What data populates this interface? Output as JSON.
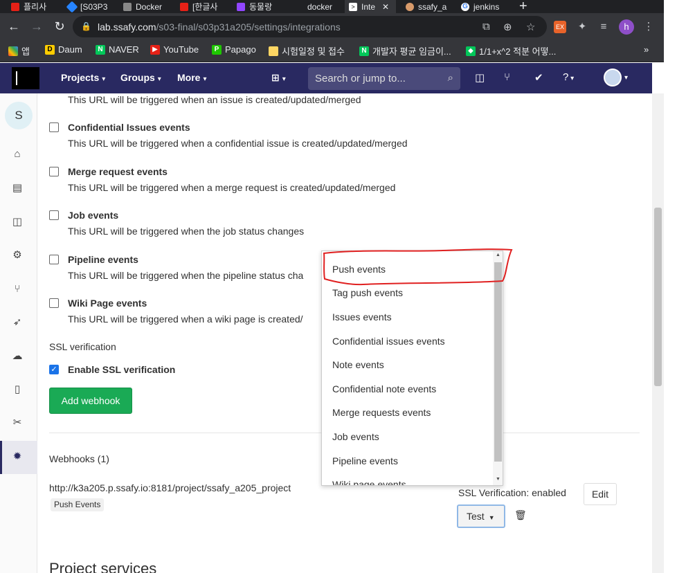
{
  "browser": {
    "tabs": [
      {
        "label": "플리사"
      },
      {
        "label": "[S03P3"
      },
      {
        "label": "Docker"
      },
      {
        "label": "[한글사"
      },
      {
        "label": "동물랑"
      },
      {
        "label": "docker"
      },
      {
        "label": "Inte"
      },
      {
        "label": "ssafy_a"
      },
      {
        "label": "jenkins"
      }
    ],
    "url_host": "lab.ssafy.com",
    "url_path": "/s03-final/s03p31a205/settings/integrations",
    "profile_initial": "h",
    "bookmarks": [
      {
        "label": "앱"
      },
      {
        "label": "Daum"
      },
      {
        "label": "NAVER"
      },
      {
        "label": "YouTube"
      },
      {
        "label": "Papago"
      },
      {
        "label": "시험일정 및 접수"
      },
      {
        "label": "개발자 평균 임금이..."
      },
      {
        "label": "1/1+x^2 적분 어떻..."
      }
    ],
    "more_bookmarks": "»"
  },
  "gitlab_nav": {
    "projects": "Projects",
    "groups": "Groups",
    "more": "More",
    "search_placeholder": "Search or jump to..."
  },
  "sidebar": {
    "project_initial": "S"
  },
  "events": {
    "top_desc": "This URL will be triggered when an issue is created/updated/merged",
    "items": [
      {
        "label": "Confidential Issues events",
        "desc": "This URL will be triggered when a confidential issue is created/updated/merged"
      },
      {
        "label": "Merge request events",
        "desc": "This URL will be triggered when a merge request is created/updated/merged"
      },
      {
        "label": "Job events",
        "desc": "This URL will be triggered when the job status changes"
      },
      {
        "label": "Pipeline events",
        "desc": "This URL will be triggered when the pipeline status cha"
      },
      {
        "label": "Wiki Page events",
        "desc": "This URL will be triggered when a wiki page is created/"
      }
    ]
  },
  "ssl": {
    "heading": "SSL verification",
    "checkbox_label": "Enable SSL verification"
  },
  "add_webhook_label": "Add webhook",
  "webhooks": {
    "title": "Webhooks (1)",
    "url": "http://k3a205.p.ssafy.io:8181/project/ssafy_a205_project",
    "badge": "Push Events",
    "ssl_status": "SSL Verification: enabled",
    "edit_label": "Edit",
    "test_label": "Test"
  },
  "dropdown": {
    "options": [
      "Push events",
      "Tag push events",
      "Issues events",
      "Confidential issues events",
      "Note events",
      "Confidential note events",
      "Merge requests events",
      "Job events",
      "Pipeline events",
      "Wiki page events"
    ]
  },
  "project_services_heading": "Project services",
  "colors": {
    "gitlab_nav": "#292961",
    "add_button": "#1aaa55",
    "annotation": "#e02020",
    "checkbox_checked": "#1a73e8"
  }
}
